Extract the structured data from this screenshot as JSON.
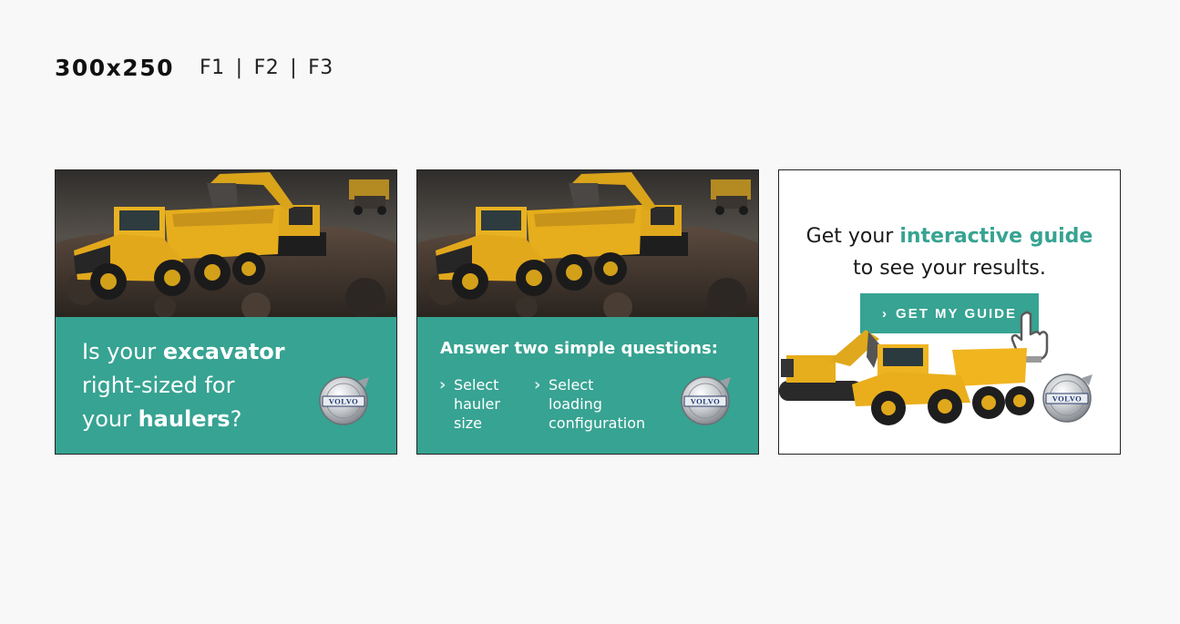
{
  "header": {
    "size": "300x250",
    "frames": [
      "F1",
      "F2",
      "F3"
    ]
  },
  "f1": {
    "line1_pre": "Is your ",
    "line1_bold": "excavator",
    "line2": "right-sized for",
    "line3_pre": "your ",
    "line3_bold": "haulers",
    "line3_post": "?",
    "logo": "VOLVO"
  },
  "f2": {
    "title": "Answer two simple questions:",
    "items": [
      {
        "lines": [
          "Select",
          "hauler",
          "size"
        ]
      },
      {
        "lines": [
          "Select",
          "loading",
          "configuration"
        ]
      }
    ],
    "logo": "VOLVO"
  },
  "f3": {
    "line1_pre": "Get your ",
    "line1_hl": "interactive guide",
    "line2": "to see your results.",
    "cta": "GET MY GUIDE",
    "logo": "VOLVO"
  },
  "colors": {
    "teal": "#37a392",
    "yellow": "#e6ad1c"
  },
  "icons": [
    "chevron-right-icon",
    "volvo-logo",
    "hand-pointer-icon"
  ]
}
